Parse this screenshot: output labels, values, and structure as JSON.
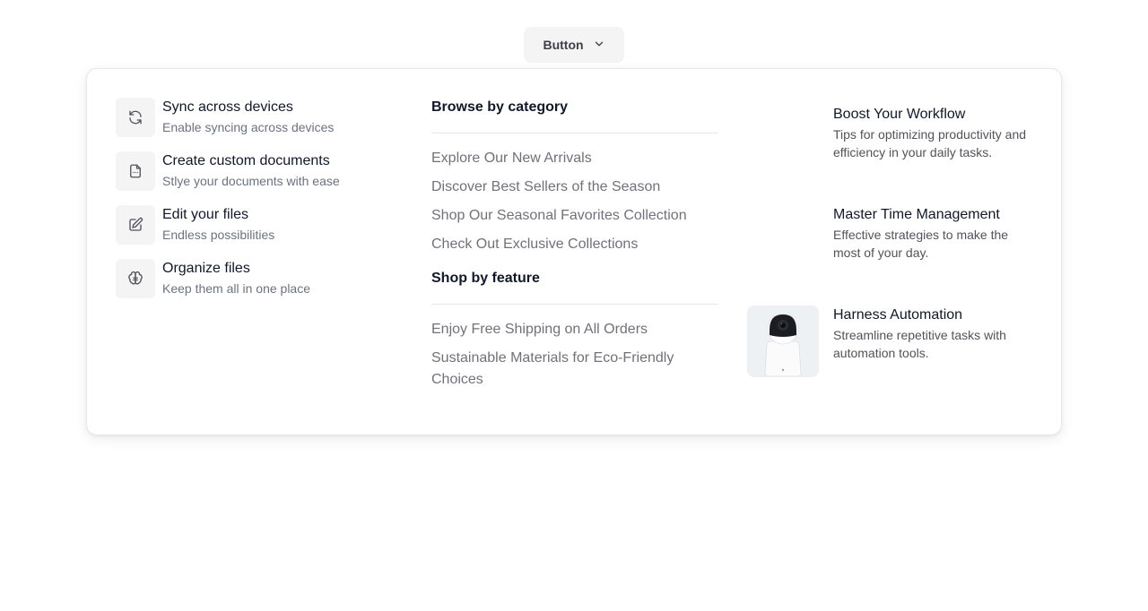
{
  "trigger": {
    "label": "Button",
    "icon": "chevron-down-icon"
  },
  "features": [
    {
      "title": "Sync across devices",
      "desc": "Enable syncing across devices",
      "icon": "sync-icon"
    },
    {
      "title": "Create custom documents",
      "desc": "Stlye your documents with ease",
      "icon": "document-icon"
    },
    {
      "title": "Edit your files",
      "desc": "Endless possibilities",
      "icon": "edit-icon"
    },
    {
      "title": "Organize files",
      "desc": "Keep them all in one place",
      "icon": "brain-icon"
    }
  ],
  "browse": {
    "heading": "Browse by category",
    "links": [
      "Explore Our New Arrivals",
      "Discover Best Sellers of the Season",
      "Shop Our Seasonal Favorites Collection",
      "Check Out Exclusive Collections"
    ]
  },
  "shop": {
    "heading": "Shop by feature",
    "links": [
      "Enjoy Free Shipping on All Orders",
      "Sustainable Materials for Eco-Friendly Choices"
    ]
  },
  "resources": [
    {
      "title": "Boost Your Workflow",
      "desc": "Tips for optimizing productivity and efficiency in your daily tasks."
    },
    {
      "title": "Master Time Management",
      "desc": "Effective strategies to make the most of your day."
    },
    {
      "title": "Harness Automation",
      "desc": "Streamline repetitive tasks with automation tools.",
      "image": "security-camera-image"
    }
  ]
}
